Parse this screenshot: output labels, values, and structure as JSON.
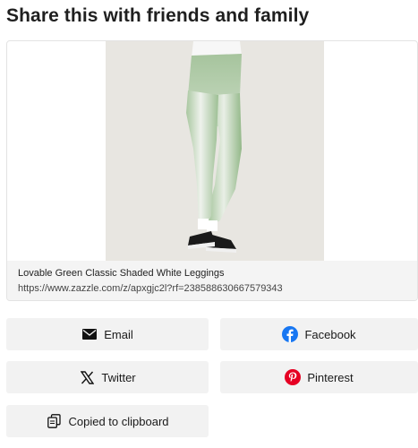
{
  "header": {
    "title": "Share this with friends and family"
  },
  "product": {
    "name": "Lovable Green Classic Shaded White Leggings",
    "url": "https://www.zazzle.com/z/apxgjc2l?rf=238588630667579343"
  },
  "share": {
    "email_label": "Email",
    "facebook_label": "Facebook",
    "twitter_label": "Twitter",
    "pinterest_label": "Pinterest",
    "copy_label": "Copied to clipboard"
  },
  "colors": {
    "facebook": "#1877f2",
    "pinterest": "#e60023",
    "button_bg": "#f2f2f2",
    "image_bg": "#e8e6e1"
  },
  "icons": {
    "email": "envelope-icon",
    "facebook": "facebook-icon",
    "twitter": "x-logo-icon",
    "pinterest": "pinterest-icon",
    "copy": "copy-icon"
  }
}
